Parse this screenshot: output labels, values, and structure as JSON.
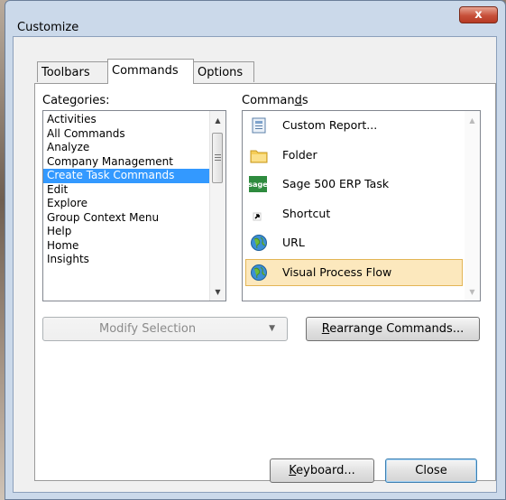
{
  "window": {
    "title": "Customize",
    "close_glyph": "x"
  },
  "tabs": [
    {
      "label": "Toolbars",
      "active": false
    },
    {
      "label": "Commands",
      "active": true
    },
    {
      "label": "Options",
      "active": false
    }
  ],
  "categories": {
    "label_before": "Cate",
    "label_mnemonic": "g",
    "label_after": "ories:",
    "items": [
      "Activities",
      "All Commands",
      "Analyze",
      "Company Management",
      "Create Task Commands",
      "Edit",
      "Explore",
      "Group Context Menu",
      "Help",
      "Home",
      "Insights"
    ],
    "selected": "Create Task Commands"
  },
  "commands": {
    "label_before": "Comman",
    "label_mnemonic": "d",
    "label_after": "s",
    "items": [
      {
        "label": "Custom Report...",
        "icon": "report-icon"
      },
      {
        "label": "Folder",
        "icon": "folder-icon"
      },
      {
        "label": "Sage 500 ERP Task",
        "icon": "sage-icon",
        "icon_text": "sage"
      },
      {
        "label": "Shortcut",
        "icon": "shortcut-arrow-icon"
      },
      {
        "label": "URL",
        "icon": "globe-icon"
      },
      {
        "label": "Visual Process Flow",
        "icon": "globe-icon",
        "selected": true
      }
    ]
  },
  "buttons": {
    "modify_selection": "Modify Selection",
    "rearrange_mnemonic": "R",
    "rearrange_rest": "earrange Commands...",
    "keyboard_mnemonic": "K",
    "keyboard_rest": "eyboard...",
    "close": "Close"
  },
  "colors": {
    "selection": "#3399ff",
    "highlight": "#fce8bd",
    "close_button": "#c7503a"
  }
}
